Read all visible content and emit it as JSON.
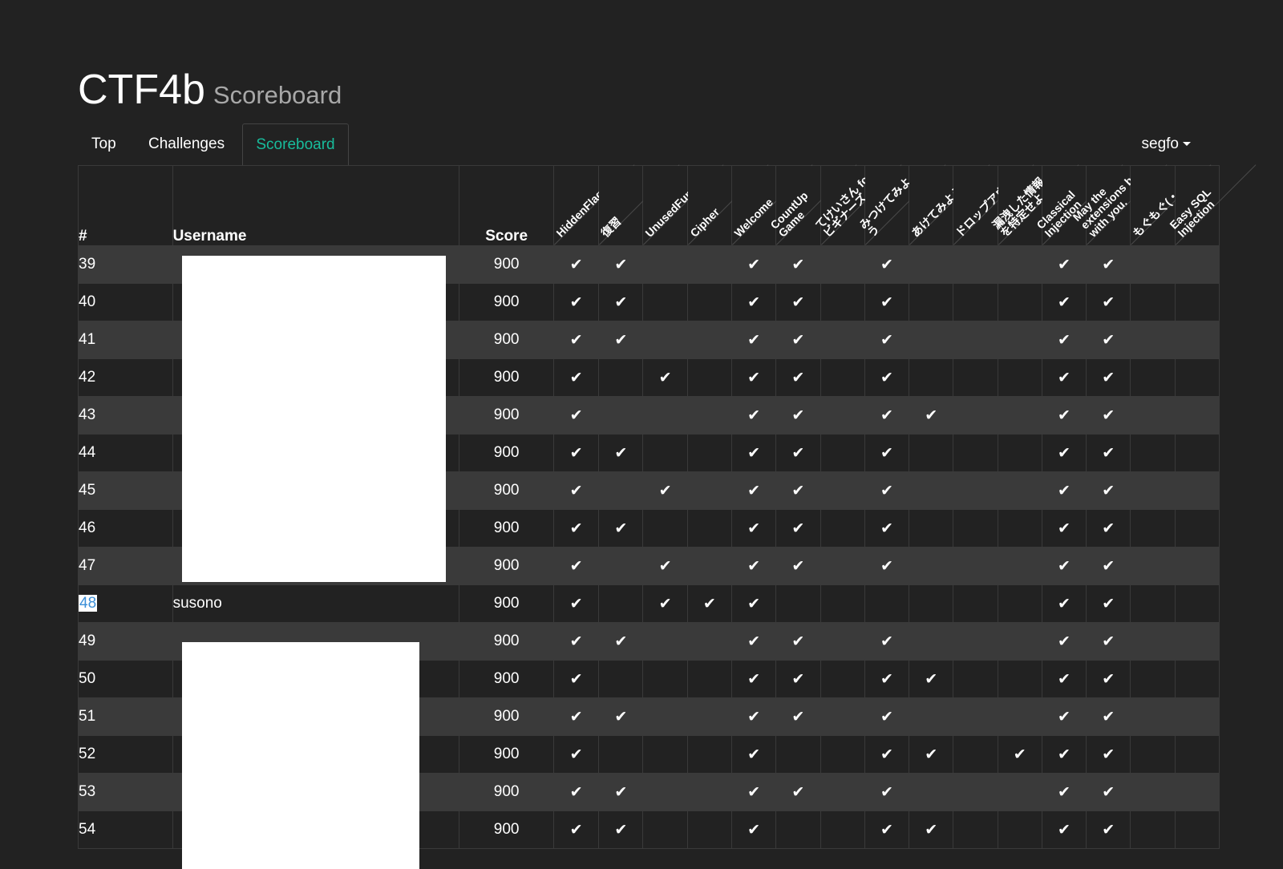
{
  "header": {
    "title": "CTF4b",
    "subtitle": "Scoreboard"
  },
  "nav": {
    "tabs": [
      {
        "label": "Top",
        "active": false
      },
      {
        "label": "Challenges",
        "active": false
      },
      {
        "label": "Scoreboard",
        "active": true
      }
    ],
    "user": "segfo"
  },
  "colors": {
    "accent": "#18bc9c",
    "background": "#222222",
    "row_alt": "#3a3a3a",
    "link": "#3b8fd8"
  },
  "table": {
    "columns": {
      "rank": "#",
      "username": "Username",
      "score": "Score"
    },
    "challenges": [
      "HiddenFlag",
      "復習",
      "UnusedFunction",
      "Cipher",
      "Welcome",
      "CountUp\nGame",
      "てけいさん for\nビギナーズ",
      "みつけてみよ\nう",
      "あけてみよう",
      "ドロップアウト",
      "漏洩した情報\nを特定せよ",
      "Classical\nInjection",
      "May the\nextensions be\nwith you.",
      "もぐもぐ(・・・)",
      "Easy SQL\nInjection"
    ],
    "check_glyph": "✔",
    "rows": [
      {
        "rank": "39",
        "username": "",
        "score": "900",
        "solved": [
          1,
          1,
          0,
          0,
          1,
          1,
          0,
          1,
          0,
          0,
          0,
          1,
          1,
          0,
          0
        ]
      },
      {
        "rank": "40",
        "username": "",
        "score": "900",
        "solved": [
          1,
          1,
          0,
          0,
          1,
          1,
          0,
          1,
          0,
          0,
          0,
          1,
          1,
          0,
          0
        ]
      },
      {
        "rank": "41",
        "username": "",
        "score": "900",
        "solved": [
          1,
          1,
          0,
          0,
          1,
          1,
          0,
          1,
          0,
          0,
          0,
          1,
          1,
          0,
          0
        ]
      },
      {
        "rank": "42",
        "username": "",
        "score": "900",
        "solved": [
          1,
          0,
          1,
          0,
          1,
          1,
          0,
          1,
          0,
          0,
          0,
          1,
          1,
          0,
          0
        ]
      },
      {
        "rank": "43",
        "username": "",
        "score": "900",
        "solved": [
          1,
          0,
          0,
          0,
          1,
          1,
          0,
          1,
          1,
          0,
          0,
          1,
          1,
          0,
          0
        ]
      },
      {
        "rank": "44",
        "username": "",
        "score": "900",
        "solved": [
          1,
          1,
          0,
          0,
          1,
          1,
          0,
          1,
          0,
          0,
          0,
          1,
          1,
          0,
          0
        ]
      },
      {
        "rank": "45",
        "username": "",
        "score": "900",
        "solved": [
          1,
          0,
          1,
          0,
          1,
          1,
          0,
          1,
          0,
          0,
          0,
          1,
          1,
          0,
          0
        ]
      },
      {
        "rank": "46",
        "username": "",
        "score": "900",
        "solved": [
          1,
          1,
          0,
          0,
          1,
          1,
          0,
          1,
          0,
          0,
          0,
          1,
          1,
          0,
          0
        ]
      },
      {
        "rank": "47",
        "username": "",
        "score": "900",
        "solved": [
          1,
          0,
          1,
          0,
          1,
          1,
          0,
          1,
          0,
          0,
          0,
          1,
          1,
          0,
          0
        ]
      },
      {
        "rank": "48",
        "username": "susono",
        "score": "900",
        "highlight": true,
        "solved": [
          1,
          0,
          1,
          1,
          1,
          0,
          0,
          0,
          0,
          0,
          0,
          1,
          1,
          0,
          0
        ]
      },
      {
        "rank": "49",
        "username": "",
        "score": "900",
        "solved": [
          1,
          1,
          0,
          0,
          1,
          1,
          0,
          1,
          0,
          0,
          0,
          1,
          1,
          0,
          0
        ]
      },
      {
        "rank": "50",
        "username": "",
        "score": "900",
        "solved": [
          1,
          0,
          0,
          0,
          1,
          1,
          0,
          1,
          1,
          0,
          0,
          1,
          1,
          0,
          0
        ]
      },
      {
        "rank": "51",
        "username": "",
        "score": "900",
        "solved": [
          1,
          1,
          0,
          0,
          1,
          1,
          0,
          1,
          0,
          0,
          0,
          1,
          1,
          0,
          0
        ]
      },
      {
        "rank": "52",
        "username": "",
        "score": "900",
        "solved": [
          1,
          0,
          0,
          0,
          1,
          0,
          0,
          1,
          1,
          0,
          1,
          1,
          1,
          0,
          0
        ]
      },
      {
        "rank": "53",
        "username": "",
        "score": "900",
        "solved": [
          1,
          1,
          0,
          0,
          1,
          1,
          0,
          1,
          0,
          0,
          0,
          1,
          1,
          0,
          0
        ]
      },
      {
        "rank": "54",
        "username": "",
        "score": "900",
        "solved": [
          1,
          1,
          0,
          0,
          1,
          0,
          0,
          1,
          1,
          0,
          0,
          1,
          1,
          0,
          0
        ]
      }
    ]
  }
}
